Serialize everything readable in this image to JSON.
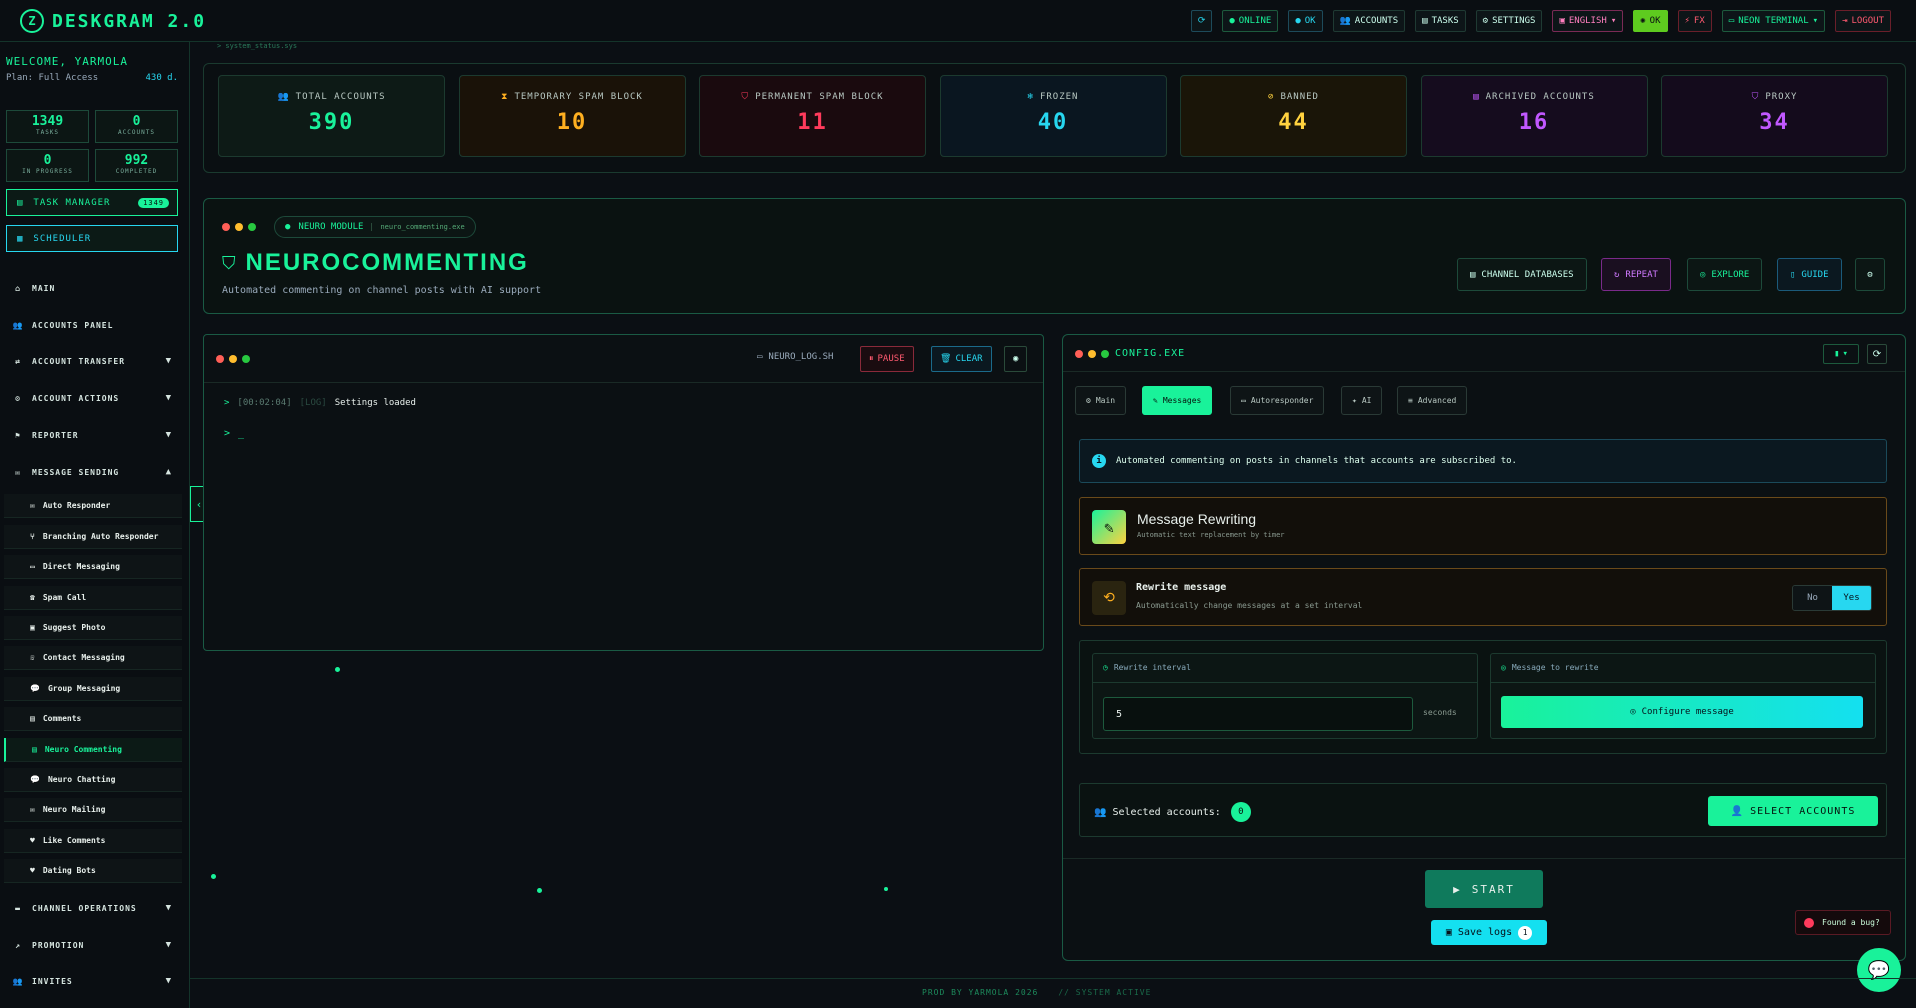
{
  "app": {
    "title": "DESKGRAM 2.0"
  },
  "topnav": {
    "online": "ONLINE",
    "ok": "OK",
    "accounts": "ACCOUNTS",
    "tasks": "TASKS",
    "settings": "SETTINGS",
    "lang": "ENGLISH",
    "ok2": "OK",
    "fx": "FX",
    "theme": "NEON TERMINAL",
    "logout": "LOGOUT"
  },
  "sidebar": {
    "welcome": "WELCOME, YARMOLA",
    "plan": "Plan: Full Access",
    "days": "430 d.",
    "stats": [
      {
        "n": "1349",
        "l": "TASKS"
      },
      {
        "n": "0",
        "l": "ACCOUNTS"
      },
      {
        "n": "0",
        "l": "IN PROGRESS"
      },
      {
        "n": "992",
        "l": "COMPLETED"
      }
    ],
    "task_manager": "TASK MANAGER",
    "task_badge": "1349",
    "scheduler": "SCHEDULER",
    "nav": [
      "MAIN",
      "ACCOUNTS PANEL",
      "ACCOUNT TRANSFER",
      "ACCOUNT ACTIONS",
      "REPORTER",
      "MESSAGE SENDING"
    ],
    "sub": [
      "Auto Responder",
      "Branching Auto Responder",
      "Direct Messaging",
      "Spam Call",
      "Suggest Photo",
      "Contact Messaging",
      "Group Messaging",
      "Comments",
      "Neuro Commenting",
      "Neuro Chatting",
      "Neuro Mailing",
      "Like Comments",
      "Dating Bots"
    ],
    "nav2": [
      "CHANNEL OPERATIONS",
      "PROMOTION",
      "INVITES"
    ]
  },
  "breadcrumb": "> system_status.sys",
  "cards": [
    {
      "title": "TOTAL ACCOUNTS",
      "value": "390",
      "color": "#19f29a"
    },
    {
      "title": "TEMPORARY SPAM BLOCK",
      "value": "10",
      "color": "#ffb020"
    },
    {
      "title": "PERMANENT SPAM BLOCK",
      "value": "11",
      "color": "#ff3b5c"
    },
    {
      "title": "FROZEN",
      "value": "40",
      "color": "#27d7f0"
    },
    {
      "title": "BANNED",
      "value": "44",
      "color": "#ffd23f"
    },
    {
      "title": "ARCHIVED ACCOUNTS",
      "value": "16",
      "color": "#c158ff"
    },
    {
      "title": "PROXY",
      "value": "34",
      "color": "#c158ff"
    }
  ],
  "module": {
    "tag": "NEURO MODULE",
    "file": "neuro_commenting.exe",
    "title": "NEUROCOMMENTING",
    "desc": "Automated commenting on channel posts with AI support",
    "buttons": {
      "databases": "CHANNEL DATABASES",
      "repeat": "REPEAT",
      "explore": "EXPLORE",
      "guide": "GUIDE"
    }
  },
  "log": {
    "file": "NEURO_LOG.SH",
    "pause": "PAUSE",
    "clear": "CLEAR",
    "time": "[00:02:04]",
    "tag": "[LOG]",
    "msg": "Settings loaded",
    "prompt": ">",
    "cursor": "_"
  },
  "config": {
    "title": "CONFIG.EXE",
    "tabs": [
      "Main",
      "Messages",
      "Autoresponder",
      "AI",
      "Advanced"
    ],
    "info": "Automated commenting on posts in channels that accounts are subscribed to.",
    "rewriting": {
      "title": "Message Rewriting",
      "sub": "Automatic text replacement by timer"
    },
    "rewrite": {
      "title": "Rewrite message",
      "sub": "Automatically change messages at a set interval",
      "no": "No",
      "yes": "Yes"
    },
    "interval": {
      "label": "Rewrite interval",
      "value": "5",
      "unit": "seconds"
    },
    "msg": {
      "label": "Message to rewrite",
      "button": "Configure message"
    },
    "selected": {
      "label": "Selected accounts:",
      "count": "0",
      "button": "SELECT ACCOUNTS"
    },
    "start": "START",
    "savelogs": "Save logs",
    "savecount": "1"
  },
  "bug": "Found a bug?",
  "footer": {
    "left": "PROD BY YARMOLA 2026",
    "right": "// SYSTEM ACTIVE"
  }
}
